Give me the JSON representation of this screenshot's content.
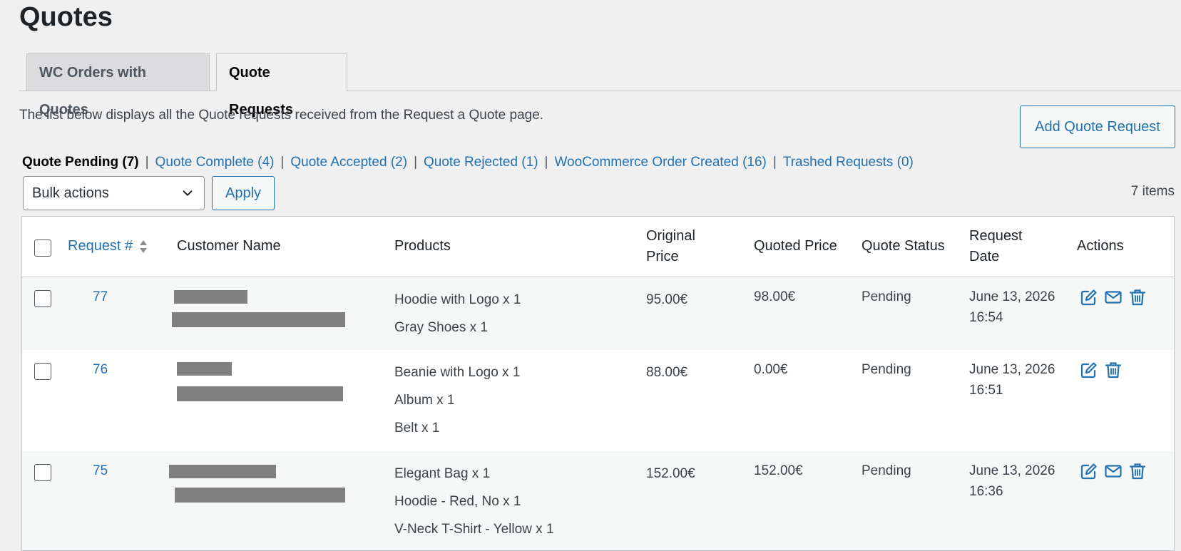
{
  "page": {
    "title": "Quotes"
  },
  "tabs": [
    {
      "label": "WC Orders with Quotes",
      "active": false
    },
    {
      "label": "Quote Requests",
      "active": true
    }
  ],
  "description": "The list below displays all the Quote requests received from the Request a Quote page.",
  "add_button": "Add Quote Request",
  "filters": {
    "current": "Quote Pending (7)",
    "links": [
      "Quote Complete (4)",
      "Quote Accepted (2)",
      "Quote Rejected (1)",
      "WooCommerce Order Created (16)",
      "Trashed Requests (0)"
    ],
    "separator": "|"
  },
  "bulk": {
    "selected": "Bulk actions",
    "apply_label": "Apply"
  },
  "items_count": "7 items",
  "table": {
    "columns": {
      "request": "Request #",
      "customer": "Customer Name",
      "products": "Products",
      "original_price_1": "Original",
      "original_price_2": "Price",
      "quoted_price": "Quoted Price",
      "status": "Quote Status",
      "date_1": "Request",
      "date_2": "Date",
      "actions": "Actions"
    },
    "rows": [
      {
        "id": "77",
        "products": [
          "Hoodie with Logo x 1",
          "Gray Shoes x 1"
        ],
        "original_price": "95.00€",
        "quoted_price": "98.00€",
        "status": "Pending",
        "date_1": "June 13, 2026",
        "date_2": "16:54",
        "actions": [
          "edit-icon",
          "mail-icon",
          "trash-icon"
        ]
      },
      {
        "id": "76",
        "products": [
          "Beanie with Logo x 1",
          "Album x 1",
          "Belt x 1"
        ],
        "original_price": "88.00€",
        "quoted_price": "0.00€",
        "status": "Pending",
        "date_1": "June 13, 2026",
        "date_2": "16:51",
        "actions": [
          "edit-icon",
          "trash-icon"
        ]
      },
      {
        "id": "75",
        "products": [
          "Elegant Bag x 1",
          "Hoodie - Red, No x 1",
          "V-Neck T-Shirt - Yellow x 1"
        ],
        "original_price": "152.00€",
        "quoted_price": "152.00€",
        "status": "Pending",
        "date_1": "June 13, 2026",
        "date_2": "16:36",
        "actions": [
          "edit-icon",
          "mail-icon",
          "trash-icon"
        ]
      }
    ]
  },
  "colors": {
    "link": "#2271b1",
    "background": "#f0f0f1",
    "redaction": "#808080"
  }
}
